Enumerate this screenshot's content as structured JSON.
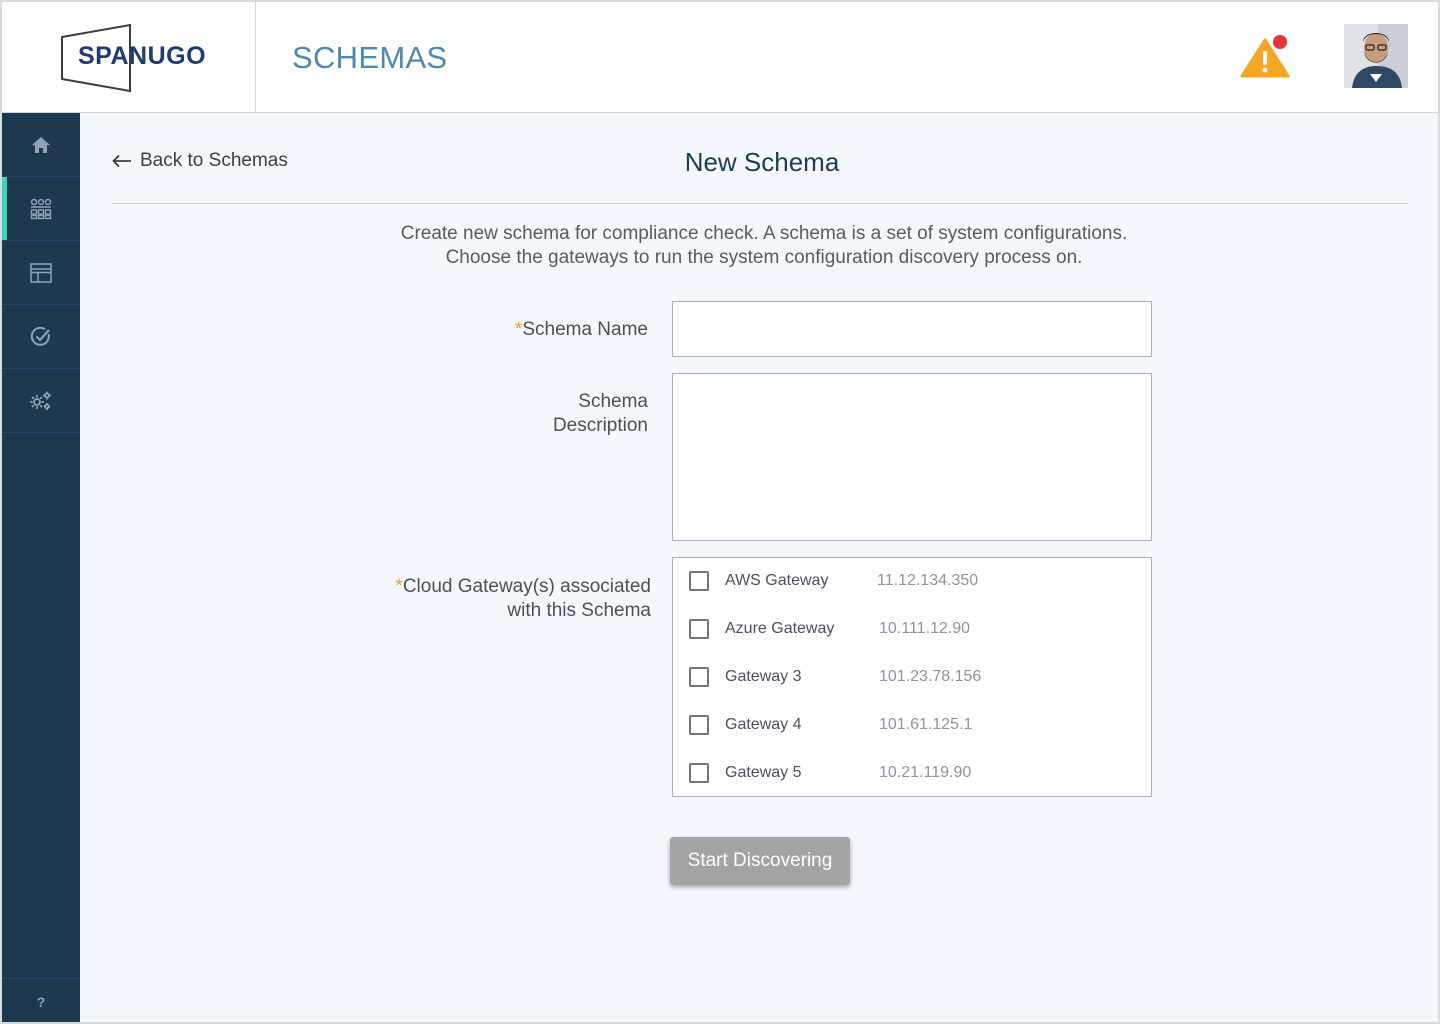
{
  "header": {
    "logo_text": "SPANUGO",
    "page_title": "SCHEMAS"
  },
  "sidebar": {
    "items": [
      {
        "name": "home",
        "icon": "home-icon",
        "active": false
      },
      {
        "name": "schemas",
        "icon": "network-icon",
        "active": true
      },
      {
        "name": "layout",
        "icon": "layout-icon",
        "active": false
      },
      {
        "name": "compliance",
        "icon": "check-circle-icon",
        "active": false
      },
      {
        "name": "settings",
        "icon": "gears-icon",
        "active": false
      }
    ],
    "help_label": "?"
  },
  "main": {
    "back_label": "Back to Schemas",
    "title": "New Schema",
    "intro_line1": "Create new schema  for compliance check. A schema is a set of system configurations.",
    "intro_line2": "Choose the gateways to run the system configuration discovery process on.",
    "schema_name_label": "Schema Name",
    "schema_desc_label_1": "Schema",
    "schema_desc_label_2": "Description",
    "gateway_label_1": "Cloud Gateway(s) associated",
    "gateway_label_2": "with this Schema",
    "required_mark": "*",
    "schema_name_value": "",
    "schema_desc_value": "",
    "gateways": [
      {
        "name": "AWS Gateway",
        "ip": "11.12.134.350",
        "checked": false
      },
      {
        "name": "Azure Gateway",
        "ip": "10.111.12.90",
        "checked": false
      },
      {
        "name": "Gateway 3",
        "ip": "101.23.78.156",
        "checked": false
      },
      {
        "name": "Gateway 4",
        "ip": "101.61.125.1",
        "checked": false
      },
      {
        "name": "Gateway 5",
        "ip": "10.21.119.90",
        "checked": false
      }
    ],
    "start_button_label": "Start Discovering"
  },
  "colors": {
    "sidebar_bg": "#1d3950",
    "active_accent": "#3fd2b4",
    "title_blue": "#4f88ad",
    "alert_orange": "#f5a623",
    "alert_dot": "#e8323c",
    "required": "#e8a31d",
    "button_disabled": "#a3a3a3"
  }
}
